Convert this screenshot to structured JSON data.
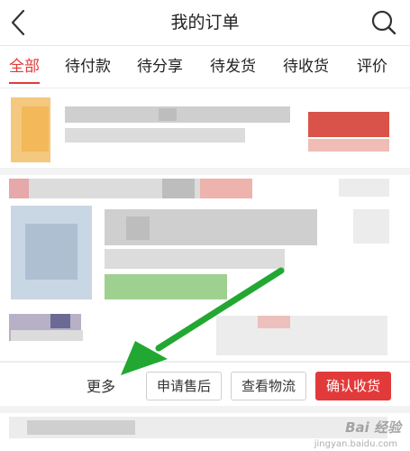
{
  "header": {
    "title": "我的订单",
    "back_icon": "back-chevron-icon",
    "search_icon": "search-icon"
  },
  "tabs": [
    {
      "label": "全部",
      "active": true
    },
    {
      "label": "待付款",
      "active": false
    },
    {
      "label": "待分享",
      "active": false
    },
    {
      "label": "待发货",
      "active": false
    },
    {
      "label": "待收货",
      "active": false
    },
    {
      "label": "评价",
      "active": false
    }
  ],
  "order_actions": {
    "more": "更多",
    "after_sale": "申请售后",
    "logistics": "查看物流",
    "confirm_receipt": "确认收货"
  },
  "colors": {
    "accent": "#e23a3a",
    "annotation_arrow": "#22a832"
  },
  "watermark": {
    "brand": "Bai 经验",
    "sub": "jingyan.baidu.com"
  }
}
